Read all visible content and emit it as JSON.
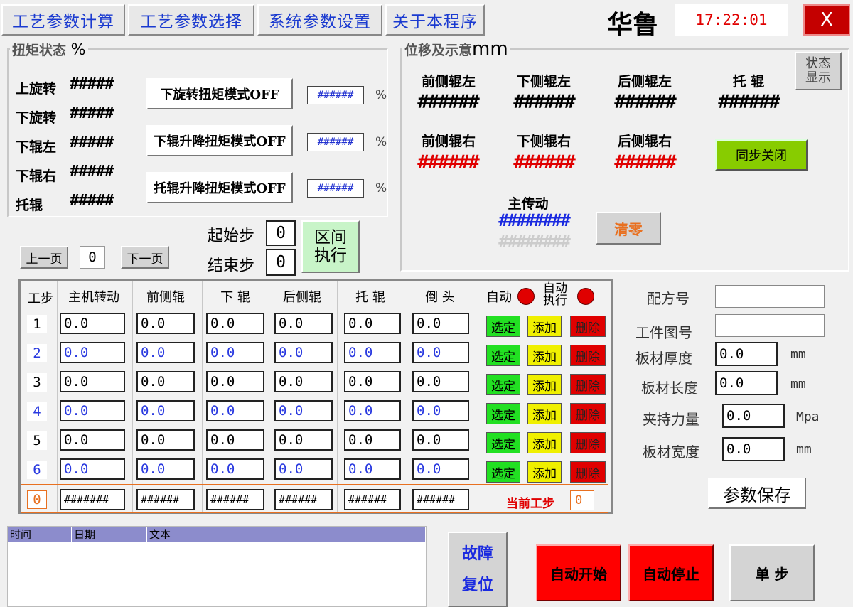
{
  "tabs": [
    {
      "label": "工艺参数计算"
    },
    {
      "label": "工艺参数选择"
    },
    {
      "label": "系统参数设置"
    },
    {
      "label": "关于本程序"
    }
  ],
  "brand": "华鲁",
  "clock": "17:22:01",
  "close_label": "X",
  "torque": {
    "title": "扭矩状态",
    "unit": "%",
    "rows": [
      {
        "label": "上旋转",
        "value": "#####"
      },
      {
        "label": "下旋转",
        "value": "#####"
      },
      {
        "label": "下辊左",
        "value": "#####"
      },
      {
        "label": "下辊右",
        "value": "#####"
      },
      {
        "label": "托辊",
        "value": "#####"
      }
    ],
    "modes": [
      {
        "label": "下旋转扭矩模式OFF",
        "value": "######",
        "unit": "%"
      },
      {
        "label": "下辊升降扭矩模式OFF",
        "value": "######",
        "unit": "%"
      },
      {
        "label": "托辊升降扭矩模式OFF",
        "value": "######",
        "unit": "%"
      }
    ]
  },
  "position": {
    "title": "位移及示意",
    "unit": "mm",
    "status_btn": "状态显示",
    "status_btn_l1": "状态",
    "status_btn_l2": "显示",
    "top": [
      {
        "label": "前侧辊左",
        "value": "######"
      },
      {
        "label": "下侧辊左",
        "value": "######"
      },
      {
        "label": "后侧辊左",
        "value": "######"
      },
      {
        "label": "托  辊",
        "value": "######"
      }
    ],
    "bottom": [
      {
        "label": "前侧辊右",
        "value": "######"
      },
      {
        "label": "下侧辊右",
        "value": "######"
      },
      {
        "label": "后侧辊右",
        "value": "######"
      }
    ],
    "sync_btn": "同步关闭",
    "main_drive": {
      "label": "主传动",
      "value": "########",
      "value2": "########"
    },
    "clear_btn": "清零"
  },
  "paging": {
    "prev": "上一页",
    "page": "0",
    "next": "下一页",
    "start_label": "起始步",
    "start_value": "0",
    "end_label": "结束步",
    "end_value": "0",
    "exec_btn_l1": "区间",
    "exec_btn_l2": "执行"
  },
  "steps_table": {
    "headers": [
      "工步",
      "主机转动",
      "前侧辊",
      "下  辊",
      "后侧辊",
      "托  辊",
      "倒  头"
    ],
    "auto_label": "自动",
    "auto_exec_label_l1": "自动",
    "auto_exec_label_l2": "执行",
    "select": "选定",
    "add": "添加",
    "delete": "删除",
    "rows": [
      {
        "step": "1",
        "values": [
          "0.0",
          "0.0",
          "0.0",
          "0.0",
          "0.0",
          "0.0"
        ]
      },
      {
        "step": "2",
        "values": [
          "0.0",
          "0.0",
          "0.0",
          "0.0",
          "0.0",
          "0.0"
        ]
      },
      {
        "step": "3",
        "values": [
          "0.0",
          "0.0",
          "0.0",
          "0.0",
          "0.0",
          "0.0"
        ]
      },
      {
        "step": "4",
        "values": [
          "0.0",
          "0.0",
          "0.0",
          "0.0",
          "0.0",
          "0.0"
        ]
      },
      {
        "step": "5",
        "values": [
          "0.0",
          "0.0",
          "0.0",
          "0.0",
          "0.0",
          "0.0"
        ]
      },
      {
        "step": "6",
        "values": [
          "0.0",
          "0.0",
          "0.0",
          "0.0",
          "0.0",
          "0.0"
        ]
      }
    ],
    "footer": {
      "step": "0",
      "values": [
        "#######",
        "######",
        "######",
        "######",
        "######",
        "######"
      ],
      "current_label": "当前工步",
      "current_value": "0"
    }
  },
  "recipe": {
    "recipe_no_label": "配方号",
    "recipe_no": "",
    "drawing_no_label": "工件图号",
    "drawing_no": "",
    "thickness_label": "板材厚度",
    "thickness": "0.0",
    "thickness_unit": "mm",
    "length_label": "板材长度",
    "length": "0.0",
    "length_unit": "mm",
    "clamp_label": "夹持力量",
    "clamp": "0.0",
    "clamp_unit": "Mpa",
    "width_label": "板材宽度",
    "width": "0.0",
    "width_unit": "mm",
    "save_btn": "参数保存"
  },
  "log": {
    "headers": [
      "时间",
      "日期",
      "文本"
    ]
  },
  "controls": {
    "fault_reset_l1": "故障",
    "fault_reset_l2": "复位",
    "auto_start": "自动开始",
    "auto_stop": "自动停止",
    "single_step": "单  步"
  },
  "colors": {
    "blue_text": "#1a3ad0",
    "red_hash": "#e00000",
    "green_btn": "#88cc00",
    "red_btn": "#ff0000"
  }
}
